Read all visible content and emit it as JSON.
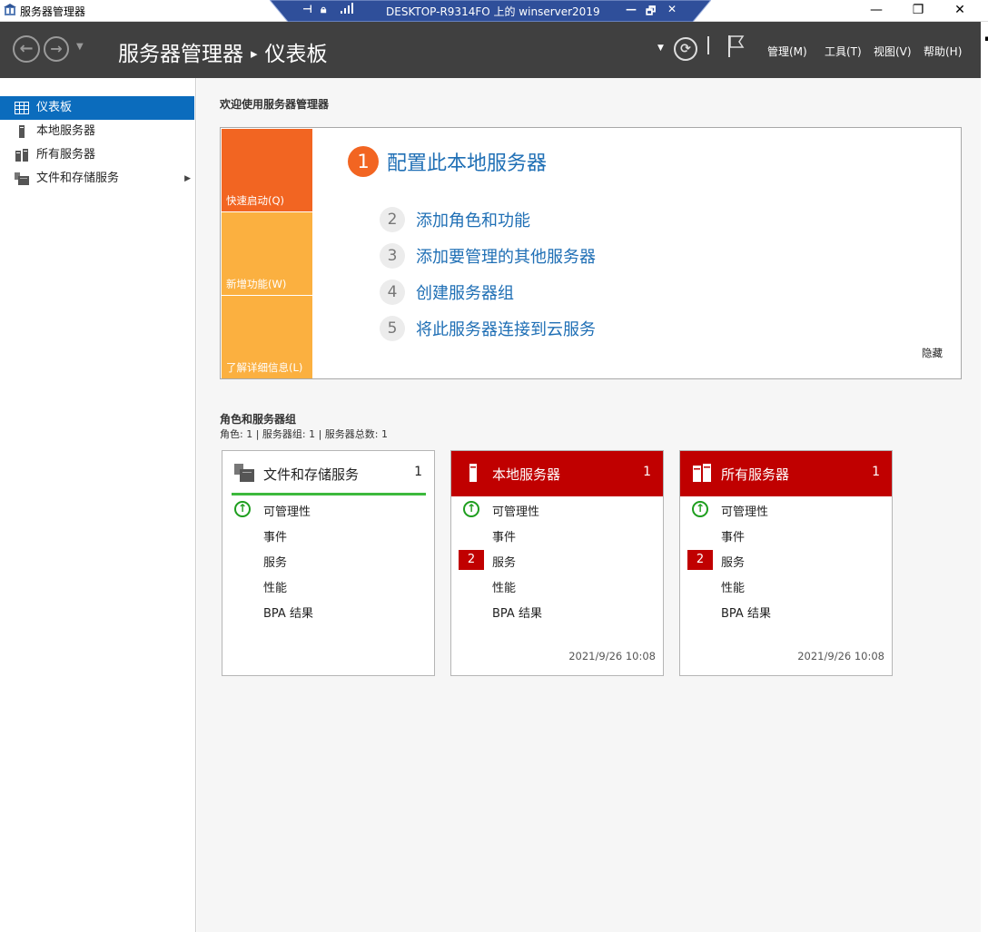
{
  "window": {
    "title": "服务器管理器",
    "rdp_title": "DESKTOP-R9314FO 上的 winserver2019",
    "minimize": "—",
    "restore": "❐",
    "close": "✕",
    "rdp_min": "—",
    "rdp_restore": "🗗",
    "rdp_close": "✕"
  },
  "header": {
    "app": "服务器管理器",
    "separator": "▸",
    "page": "仪表板",
    "menus": [
      "管理(M)",
      "工具(T)",
      "视图(V)",
      "帮助(H)"
    ]
  },
  "sidebar": {
    "items": [
      {
        "label": "仪表板",
        "active": true
      },
      {
        "label": "本地服务器"
      },
      {
        "label": "所有服务器"
      },
      {
        "label": "文件和存储服务"
      }
    ]
  },
  "welcome": {
    "title": "欢迎使用服务器管理器",
    "tiles": [
      "快速启动(Q)",
      "新增功能(W)",
      "了解详细信息(L)"
    ],
    "primary_step": {
      "num": "1",
      "label": "配置此本地服务器"
    },
    "steps": [
      {
        "num": "2",
        "label": "添加角色和功能"
      },
      {
        "num": "3",
        "label": "添加要管理的其他服务器"
      },
      {
        "num": "4",
        "label": "创建服务器组"
      },
      {
        "num": "5",
        "label": "将此服务器连接到云服务"
      }
    ],
    "hide": "隐藏"
  },
  "roles": {
    "title": "角色和服务器组",
    "subtitle": "角色: 1 | 服务器组: 1 | 服务器总数: 1",
    "cards": [
      {
        "title": "文件和存储服务",
        "count": "1",
        "rows": [
          "可管理性",
          "事件",
          "服务",
          "性能",
          "BPA 结果"
        ],
        "services_badge": "",
        "timestamp": ""
      },
      {
        "title": "本地服务器",
        "count": "1",
        "rows": [
          "可管理性",
          "事件",
          "服务",
          "性能",
          "BPA 结果"
        ],
        "services_badge": "2",
        "timestamp": "2021/9/26 10:08"
      },
      {
        "title": "所有服务器",
        "count": "1",
        "rows": [
          "可管理性",
          "事件",
          "服务",
          "性能",
          "BPA 结果"
        ],
        "services_badge": "2",
        "timestamp": "2021/9/26 10:08"
      }
    ]
  },
  "colors": {
    "accent": "#0b6cbd",
    "alert": "#c00000",
    "quick_start": "#f26522",
    "tile": "#fbb040",
    "ok": "#1e9e1e"
  }
}
